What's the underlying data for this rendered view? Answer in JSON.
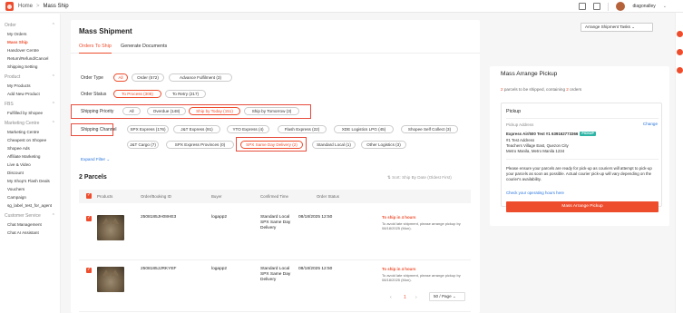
{
  "topbar": {
    "breadcrumb_home": "Home",
    "breadcrumb_sep": ">",
    "breadcrumb_current": "Mass Ship",
    "user": "diagonalley"
  },
  "sidebar": {
    "groups": [
      {
        "title": "Order",
        "items": [
          "My Orders",
          "Mass Ship",
          "Handover Centre",
          "Return/Refund/Cancel",
          "Shipping Setting"
        ]
      },
      {
        "title": "Product",
        "items": [
          "My Products",
          "Add New Product"
        ]
      },
      {
        "title": "FBS",
        "items": [
          "Fulfilled by Shopee"
        ]
      },
      {
        "title": "Marketing Centre",
        "items": [
          "Marketing Centre",
          "Cheapest on Shopee",
          "Shopee Ads",
          "Affiliate Marketing",
          "Live & Video",
          "Discount",
          "My Shop's Flash Deals",
          "Vouchers",
          "Campaign",
          "sg_label_test_for_agent"
        ]
      },
      {
        "title": "Customer Service",
        "items": [
          "Chat Management",
          "Chat AI Assistant"
        ]
      }
    ],
    "active_item": "Mass Ship"
  },
  "main": {
    "title": "Mass Shipment",
    "tabs": [
      "Orders To Ship",
      "Generate Documents"
    ],
    "order_type_label": "Order Type",
    "order_type": [
      "All",
      "Order (572)",
      "Advance Fulfilment (3)"
    ],
    "order_status_label": "Order Status",
    "order_status": [
      "To Process (308)",
      "To Retry (217)"
    ],
    "shipping_priority_label": "Shipping Priority",
    "shipping_priority": [
      "All",
      "Overdue (148)",
      "Ship by Today (151)",
      "Ship by Tomorrow (3)"
    ],
    "shipping_channel_label": "Shipping Channel",
    "shipping_channels_row1": [
      "SPX Express (176)",
      "J&T Express (91)",
      "YTO Express (4)",
      "Flash Express (22)",
      "XDE Logistics LPG (45)",
      "Shopee Self Collect (3)"
    ],
    "shipping_channels_row2": [
      "J&T Cargo (7)",
      "SPX Express Provinces (0)",
      "SPX Same Day Delivery (2)",
      "Standard Local (1)",
      "Other Logistics (3)"
    ],
    "expand_filter": "Expand Filter ⌄",
    "parcels_title": "2 Parcels",
    "sort_label": "⇅ Sort: Ship By Date (Oldest First)",
    "table_headers": [
      "Products",
      "Order/Booking ID",
      "Buyer",
      "Confirmed Time",
      "Order Status"
    ],
    "rows": [
      {
        "order_id": "2508185JH08HE3",
        "buyer": "logapp2",
        "channel": [
          "Standard Local",
          "SPX Same Day",
          "Delivery"
        ],
        "time": "08/18/2025 12:50",
        "status": "To ship in 4 hours",
        "note": "To avoid late shipment, please arrange pickup by 08/18/2025 (Mon)."
      },
      {
        "order_id": "2508185JJRKYEF",
        "buyer": "logapp2",
        "channel": [
          "Standard Local",
          "SPX Same Day",
          "Delivery"
        ],
        "time": "08/18/2025 12:50",
        "status": "To ship in 4 hours",
        "note": "To avoid late shipment, please arrange pickup by 08/18/2025 (Mon)."
      }
    ],
    "pagination": {
      "prev": "‹",
      "current": "1",
      "next": "›",
      "page_size": "50 / Page ⌄"
    }
  },
  "arrange_tasks_button": "Arrange Shipment Tasks ⌄",
  "panel": {
    "title": "Mass Arrange Pickup",
    "subtitle_prefix": "2",
    "subtitle_text": " parcels to be shipped, containing ",
    "subtitle_orders": "2",
    "subtitle_suffix": " orders",
    "pickup_header": "Pickup",
    "pickup_address_label": "Pickup Address",
    "change": "Change",
    "contact": "Express Air/500 Test #1 639162773366",
    "tag": "PICKUP",
    "address_lines": [
      "#1 Test Address",
      "Teachers Village East, Quezon City",
      "Metro Manila, Metro Manila 1234"
    ],
    "notice": "Please ensure your parcels are ready for pick-up as couriers will attempt to pick-up your parcels as soon as possible. Actual courier pick-up will vary depending on the courier's availability.",
    "hours_link": "Check your operating hours here",
    "button": "Mass Arrange Pickup"
  },
  "colors": {
    "accent": "#ee4d2d",
    "link": "#2673dd",
    "highlight_box": "#e74c3c"
  }
}
